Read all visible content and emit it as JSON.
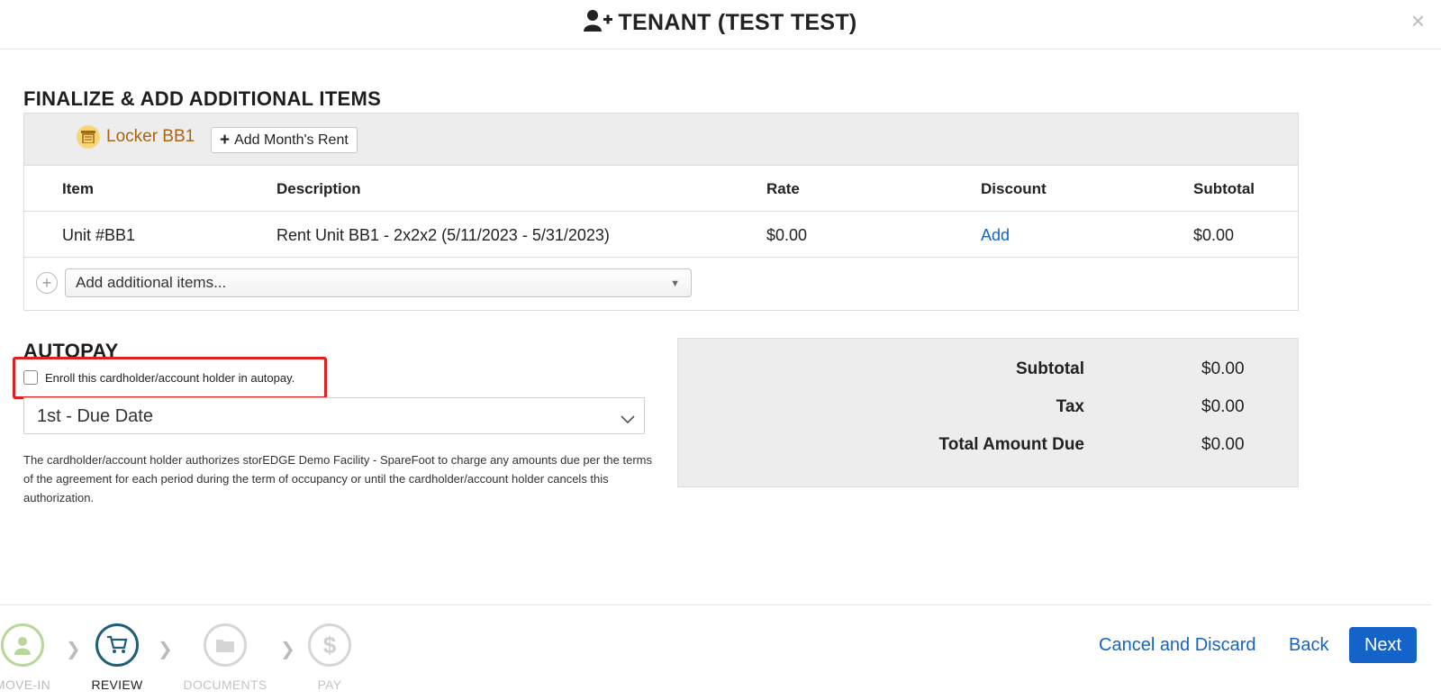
{
  "header": {
    "title": "TENANT (TEST TEST)",
    "close": "×"
  },
  "sections": {
    "finalize_title": "FINALIZE & ADD ADDITIONAL ITEMS",
    "autopay_title": "AUTOPAY"
  },
  "unit": {
    "label": "Locker BB1",
    "add_rent_label": "Add Month's Rent"
  },
  "table": {
    "headers": [
      "Item",
      "Description",
      "Rate",
      "Discount",
      "Subtotal"
    ],
    "rows": [
      {
        "item": "Unit #BB1",
        "description": "Rent Unit BB1 - 2x2x2 (5/11/2023 - 5/31/2023)",
        "rate": "$0.00",
        "discount": "Add",
        "subtotal": "$0.00"
      }
    ]
  },
  "add_items": {
    "placeholder": "Add additional items..."
  },
  "autopay": {
    "checkbox_label": "Enroll this cardholder/account holder in autopay.",
    "due_select": "1st - Due Date",
    "auth_text": "The cardholder/account holder authorizes storEDGE Demo Facility - SpareFoot to charge any amounts due per the terms of the agreement for each period during the term of occupancy or until the cardholder/account holder cancels this authorization."
  },
  "totals": {
    "subtotal_label": "Subtotal",
    "subtotal": "$0.00",
    "tax_label": "Tax",
    "tax": "$0.00",
    "total_label": "Total Amount Due",
    "total": "$0.00"
  },
  "steps": [
    {
      "label": "MOVE-IN",
      "state": "done"
    },
    {
      "label": "REVIEW",
      "state": "active"
    },
    {
      "label": "DOCUMENTS",
      "state": "pending"
    },
    {
      "label": "PAY",
      "state": "pending"
    }
  ],
  "footer": {
    "cancel": "Cancel and Discard",
    "back": "Back",
    "next": "Next"
  },
  "colors": {
    "accent": "#1463c8",
    "link": "#1565c0",
    "highlight": "#e02020",
    "step_active": "#1f5f78",
    "step_done": "#b7d89a",
    "unit_text": "#a9650f"
  }
}
